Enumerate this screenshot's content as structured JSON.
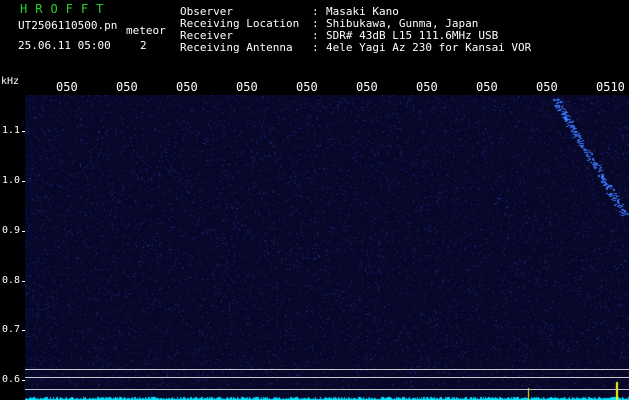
{
  "header": {
    "app_title": "HROFFT",
    "filename": "UT2506110500.pn",
    "meteor_label": "meteor",
    "datetime": "25.06.11 05:00",
    "count": "2",
    "fields": [
      {
        "label": "Observer",
        "value": "Masaki Kano"
      },
      {
        "label": "Receiving Location",
        "value": "Shibukawa, Gunma, Japan"
      },
      {
        "label": "Receiver",
        "value": "SDR# 43dB L15 111.6MHz USB"
      },
      {
        "label": "Receiving Antenna",
        "value": "4ele Yagi Az 230 for Kansai VOR"
      }
    ]
  },
  "y_axis": {
    "unit": "kHz",
    "ticks": [
      "1.1",
      "1.0",
      "0.9",
      "0.8",
      "0.7",
      "0.6"
    ]
  },
  "x_axis": {
    "ticks": [
      "050",
      "050",
      "050",
      "050",
      "050",
      "050",
      "050",
      "050",
      "050",
      "0510"
    ]
  },
  "colors": {
    "background": "#07072a",
    "title_green": "#29d129",
    "echo_blue": "#3a78ff",
    "spectrum_cyan": "#00e5ff",
    "spike_yellow": "#ffff00"
  }
}
